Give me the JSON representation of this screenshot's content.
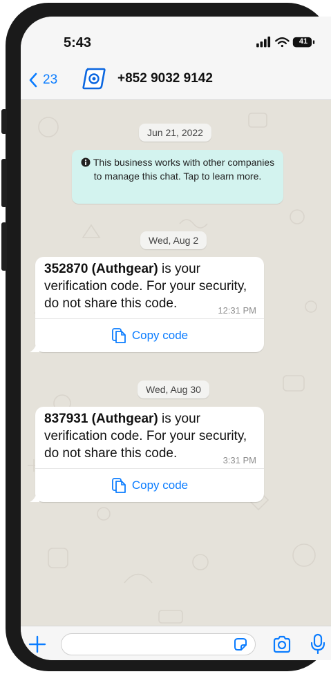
{
  "status_bar": {
    "time": "5:43",
    "battery": "41"
  },
  "nav": {
    "back_count": "23",
    "contact_name": "+852 9032 9142"
  },
  "chat": {
    "system_notice": "This business works with other companies to manage this chat. Tap to learn more.",
    "date_chips": [
      "Jun 21, 2022",
      "Wed, Aug 2",
      "Wed, Aug 30"
    ],
    "messages": [
      {
        "code": "352870 (Authgear)",
        "text": " is your verification code. For your security, do not share this code.",
        "time": "12:31 PM",
        "action": "Copy code"
      },
      {
        "code": "837931 (Authgear)",
        "text": " is your verification code. For your security, do not share this code.",
        "time": "3:31 PM",
        "action": "Copy code"
      }
    ]
  },
  "composer": {
    "value": "",
    "placeholder": ""
  },
  "colors": {
    "accent": "#0a7cff",
    "notice_bg": "#d3f3ef",
    "chat_bg": "#e5e2da"
  }
}
